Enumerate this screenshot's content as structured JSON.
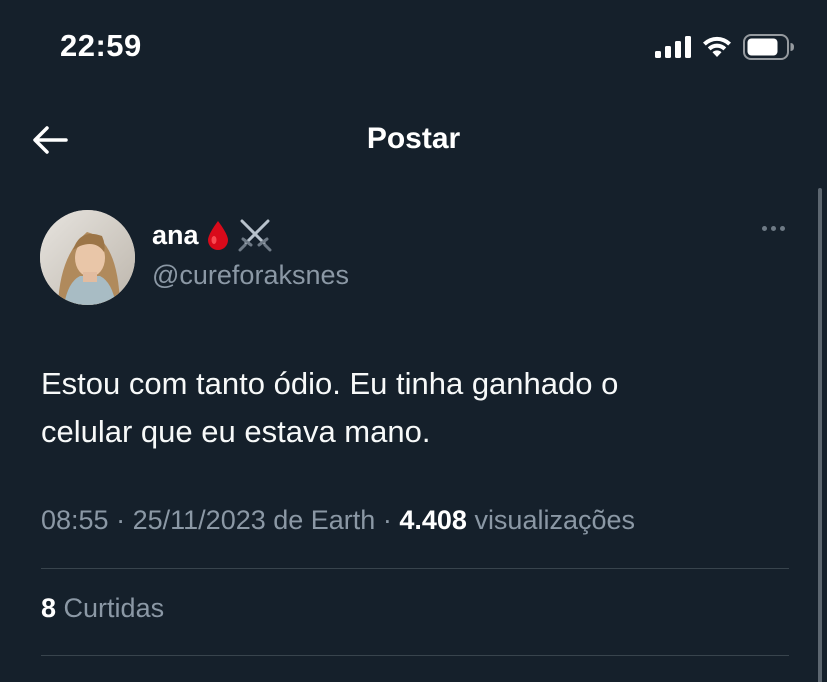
{
  "status_bar": {
    "time": "22:59"
  },
  "header": {
    "title": "Postar"
  },
  "post": {
    "author_name": "ana",
    "author_emojis": [
      "drop-of-blood",
      "crossed-swords"
    ],
    "author_handle": "@cureforaksnes",
    "text_line_1": "Estou com tanto ódio. Eu tinha ganhado o",
    "text_line_2": "celular que eu estava mano.",
    "time": "08:55",
    "separator": "·",
    "date_source": "25/11/2023 de Earth",
    "views_count": "4.408",
    "views_label": "visualizações",
    "likes_count": "8",
    "likes_label": "Curtidas"
  },
  "colors": {
    "background": "#15202b",
    "text_primary": "#f7f9f9",
    "text_secondary": "#8b98a5",
    "divider": "#38444d"
  }
}
